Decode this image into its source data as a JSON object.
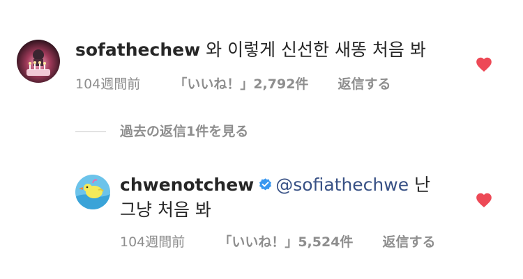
{
  "comments": [
    {
      "username": "sofathechew",
      "text": "와 이렇게 신선한 새똥 처음 봐",
      "time": "104週間前",
      "likes": "「いいね！」2,792件",
      "reply": "返信する",
      "liked": true,
      "avatar_icon": "birthday-cake-photo"
    },
    {
      "username": "chwenotchew",
      "verified": true,
      "mention": "@sofiathechwe",
      "text_line1": "난",
      "text_line2": "그냥 처음 봐",
      "time": "104週間前",
      "likes": "「いいね！」5,524件",
      "reply": "返信する",
      "liked": true,
      "avatar_icon": "cartoon-duck-illustration"
    }
  ],
  "view_replies": "過去の返信1件を見る",
  "colors": {
    "heart": "#ED4956",
    "mention": "#385185",
    "verified": "#3897F0",
    "meta": "#8E8E8E"
  }
}
